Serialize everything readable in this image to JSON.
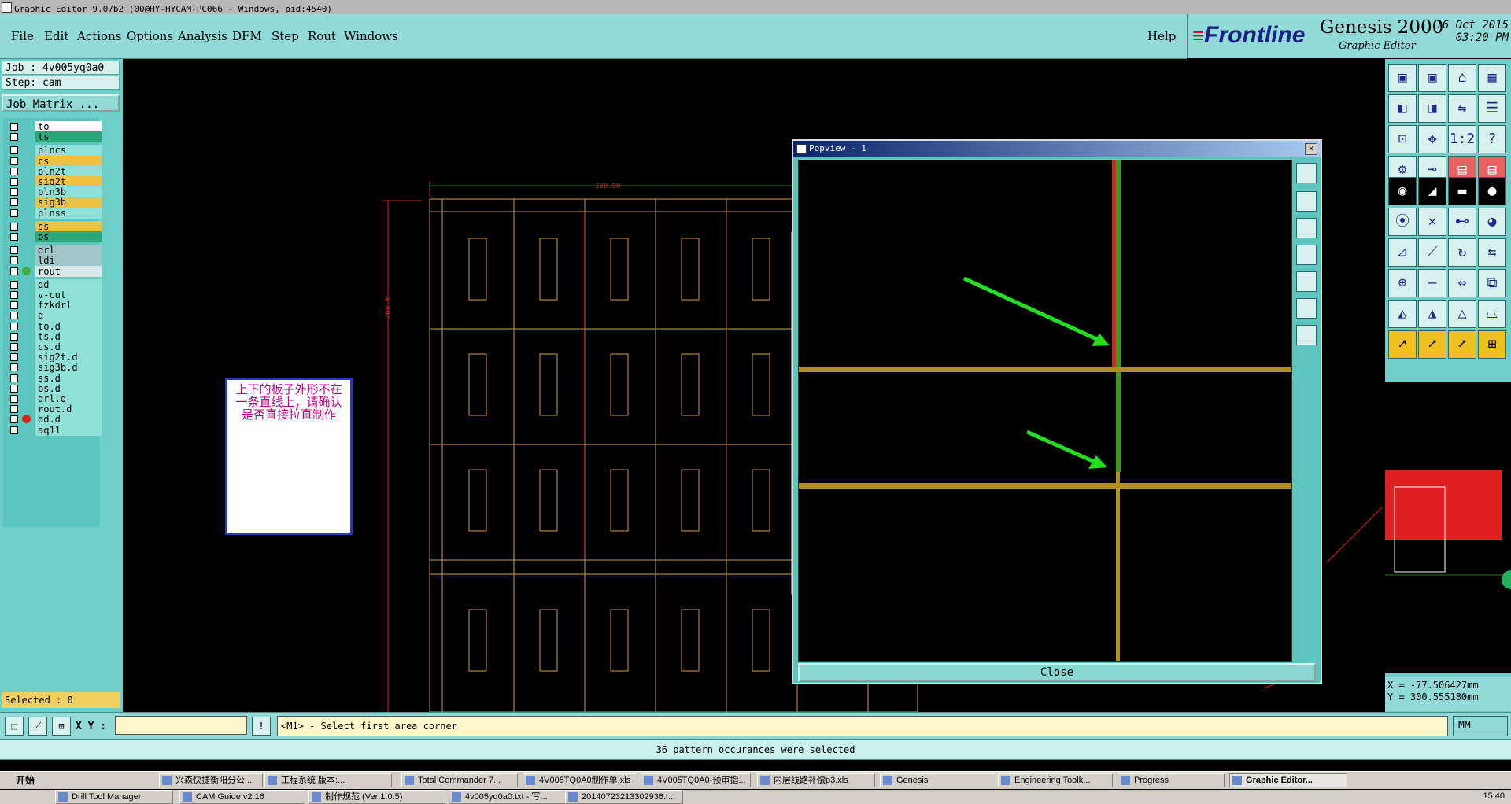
{
  "window_title": "Graphic Editor 9.07b2 (00@HY-HYCAM-PC066 - Windows, pid:4540)",
  "menu": [
    "File",
    "Edit",
    "Actions",
    "Options",
    "Analysis",
    "DFM",
    "Step",
    "Rout",
    "Windows"
  ],
  "help_label": "Help",
  "brand": {
    "logo_prefix": "≡",
    "logo": "Frontline",
    "product": "Genesis 2000",
    "subtitle": "Graphic Editor",
    "date": "16 Oct 2015",
    "time": "03:20 PM"
  },
  "job": {
    "job_label": "Job : 4v005yq0a0",
    "step_label": "Step: cam",
    "matrix_button": "Job Matrix ..."
  },
  "layers": [
    {
      "name": "to",
      "color": "#ffffff",
      "group": 0
    },
    {
      "name": "ts",
      "color": "#2aa87a",
      "group": 0
    },
    {
      "name": "plncs",
      "color": "#8fe0d6",
      "group": 1
    },
    {
      "name": "cs",
      "color": "#f0c040",
      "group": 1
    },
    {
      "name": "pln2t",
      "color": "#8fe0d6",
      "group": 1
    },
    {
      "name": "sig2t",
      "color": "#f0c040",
      "group": 1
    },
    {
      "name": "pln3b",
      "color": "#8fe0d6",
      "group": 1
    },
    {
      "name": "sig3b",
      "color": "#f0c040",
      "group": 1
    },
    {
      "name": "plnss",
      "color": "#8fe0d6",
      "group": 1
    },
    {
      "name": "ss",
      "color": "#f0c040",
      "group": 2
    },
    {
      "name": "bs",
      "color": "#2aa87a",
      "group": 2
    },
    {
      "name": "drl",
      "color": "#a0c4c8",
      "group": 3
    },
    {
      "name": "ldi",
      "color": "#a0c4c8",
      "group": 3
    },
    {
      "name": "rout",
      "color": "#d8e8e6",
      "group": 3,
      "dot": "#3fb040"
    },
    {
      "name": "dd",
      "color": "#8fe0d6",
      "group": 4
    },
    {
      "name": "v-cut",
      "color": "#8fe0d6",
      "group": 4
    },
    {
      "name": "fzkdrl",
      "color": "#8fe0d6",
      "group": 4
    },
    {
      "name": "d",
      "color": "#8fe0d6",
      "group": 4
    },
    {
      "name": "to.d",
      "color": "#8fe0d6",
      "group": 4
    },
    {
      "name": "ts.d",
      "color": "#8fe0d6",
      "group": 4
    },
    {
      "name": "cs.d",
      "color": "#8fe0d6",
      "group": 4
    },
    {
      "name": "sig2t.d",
      "color": "#8fe0d6",
      "group": 4
    },
    {
      "name": "sig3b.d",
      "color": "#8fe0d6",
      "group": 4
    },
    {
      "name": "ss.d",
      "color": "#8fe0d6",
      "group": 4
    },
    {
      "name": "bs.d",
      "color": "#8fe0d6",
      "group": 4
    },
    {
      "name": "drl.d",
      "color": "#8fe0d6",
      "group": 4
    },
    {
      "name": "rout.d",
      "color": "#8fe0d6",
      "group": 4
    },
    {
      "name": "dd.d",
      "color": "#8fe0d6",
      "group": 4,
      "dot": "#e02020"
    },
    {
      "name": "aq11",
      "color": "#8fe0d6",
      "group": 4
    }
  ],
  "selected_label": "Selected : 0",
  "canvas": {
    "dim_top": "160.00",
    "dim_left": "200.3"
  },
  "note_text": "上下的板子外形不在一条直线上，请确认是否直接拉直制作",
  "popview": {
    "title": "Popview - 1",
    "close_x": "✕",
    "close_button": "Close"
  },
  "coords": {
    "x": "X = -77.506427mm",
    "y": "Y = 300.555180mm"
  },
  "cmd": {
    "xy_label": "X Y :",
    "xy_value": "",
    "prompt": "<M1> - Select first area corner",
    "units": "MM"
  },
  "status_message": "36 pattern occurances were selected",
  "taskbar": {
    "start": "开始",
    "row1": [
      "兴森快捷衡阳分公...",
      "工程系统  版本:...",
      "Total Commander 7...",
      "4V005TQ0A0制作单.xls",
      "4V005TQ0A0-预审指...",
      "内层线路补偿p3.xls",
      "Genesis",
      "Engineering Toolk...",
      "Progress",
      "Graphic Editor..."
    ],
    "row2": [
      "Drill Tool Manager",
      "CAM Guide v2.16",
      "制作规范 (Ver:1.0.5)",
      "4v005yq0a0.txt - 写...",
      "20140723213302936.r..."
    ],
    "clock": "15:40"
  },
  "colors": {
    "panel": "#6dcfc8",
    "menubar": "#92dad8",
    "board_outline": "#c8a040",
    "route": "#e06020",
    "highlight_red": "#e02020",
    "highlight_green": "#40a020",
    "arrow": "#20e020"
  }
}
